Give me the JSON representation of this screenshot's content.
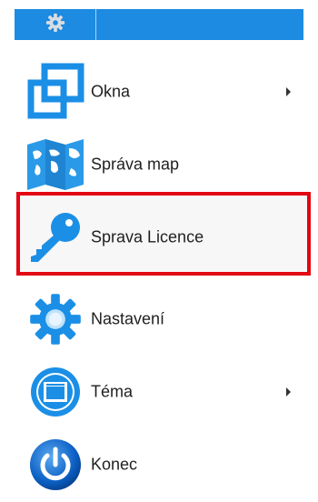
{
  "toolbar": {
    "icon": "gear-icon"
  },
  "menu": {
    "items": [
      {
        "label": "Okna",
        "icon": "windows-icon",
        "has_submenu": true
      },
      {
        "label": "Správa map",
        "icon": "map-icon",
        "has_submenu": false
      },
      {
        "label": "Sprava Licence",
        "icon": "key-icon",
        "has_submenu": false,
        "selected": true
      },
      {
        "label": "Nastavení",
        "icon": "gear-settings-icon",
        "has_submenu": false
      },
      {
        "label": "Téma",
        "icon": "theme-icon",
        "has_submenu": true
      },
      {
        "label": "Konec",
        "icon": "power-icon",
        "has_submenu": false
      }
    ]
  },
  "colors": {
    "toolbar_bg": "#1c8be1",
    "icon_blue": "#1b8fe6",
    "selection_border": "#e30613"
  }
}
